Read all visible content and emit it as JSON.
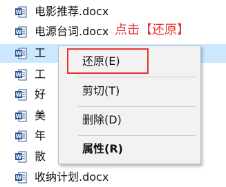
{
  "files": [
    {
      "name": "电影推荐.docx"
    },
    {
      "name": "电源台词.docx"
    },
    {
      "name": "工"
    },
    {
      "name": "工"
    },
    {
      "name": "好"
    },
    {
      "name": "美"
    },
    {
      "name": "年"
    },
    {
      "name": "散"
    },
    {
      "name": "收纳计划.docx"
    }
  ],
  "file_icon": {
    "name": "word-document-icon",
    "letter": "W",
    "color": "#2b579a"
  },
  "annotation": "点击【还原】",
  "context_menu": {
    "items": [
      {
        "label": "还原(E)"
      },
      {
        "label": "剪切(T)"
      },
      {
        "label": "删除(D)"
      },
      {
        "label": "属性(R)"
      }
    ]
  },
  "colors": {
    "selection": "#cce8ff",
    "annotation": "#e8312f",
    "highlight_box": "#e2342c"
  }
}
